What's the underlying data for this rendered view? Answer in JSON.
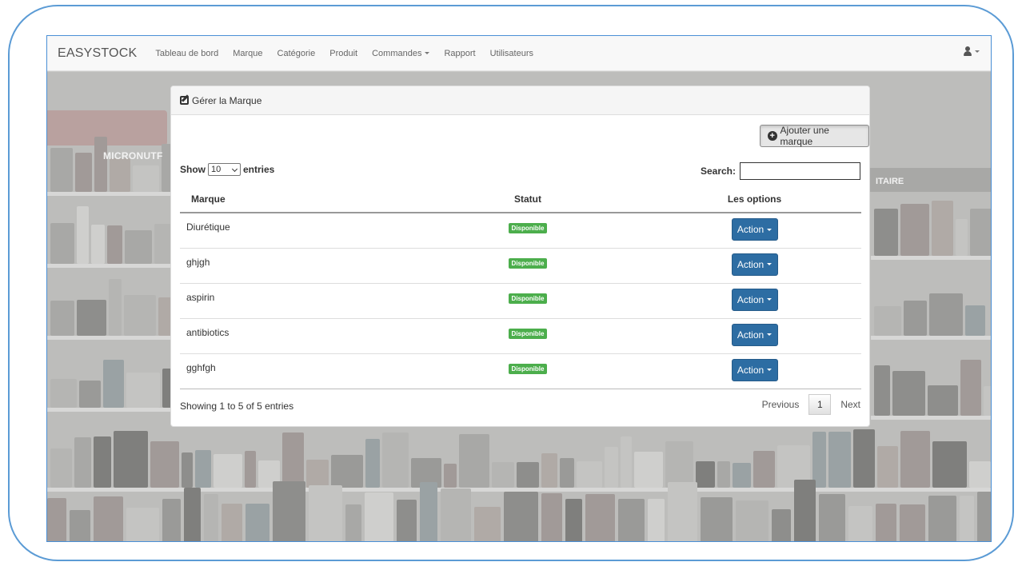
{
  "navbar": {
    "brand": "EASYSTOCK",
    "items": [
      {
        "label": "Tableau de bord"
      },
      {
        "label": "Marque"
      },
      {
        "label": "Catégorie"
      },
      {
        "label": "Produit"
      },
      {
        "label": "Commandes",
        "dropdown": true
      },
      {
        "label": "Rapport"
      },
      {
        "label": "Utilisateurs"
      }
    ],
    "user_icon": "user-icon"
  },
  "background": {
    "sign_left": "MICRONUTF",
    "sign_right": "ITAIRE"
  },
  "panel": {
    "title": "Gérer la Marque",
    "add_button_label": "Ajouter une marque",
    "length": {
      "show_label": "Show",
      "value": "10",
      "entries_label": "entries"
    },
    "search_label": "Search:",
    "search_value": "",
    "columns": [
      "Marque",
      "Statut",
      "Les options"
    ],
    "rows": [
      {
        "marque": "Diurétique",
        "statut": "Disponible",
        "action": "Action"
      },
      {
        "marque": "ghjgh",
        "statut": "Disponible",
        "action": "Action"
      },
      {
        "marque": "aspirin",
        "statut": "Disponible",
        "action": "Action"
      },
      {
        "marque": "antibiotics",
        "statut": "Disponible",
        "action": "Action"
      },
      {
        "marque": "gghfgh",
        "statut": "Disponible",
        "action": "Action"
      }
    ],
    "info": "Showing 1 to 5 of 5 entries",
    "pagination": {
      "previous": "Previous",
      "page": "1",
      "next": "Next"
    }
  },
  "colors": {
    "frame_border": "#5b9bd5",
    "badge_green": "#4cae4c",
    "action_blue": "#2d6da3"
  }
}
